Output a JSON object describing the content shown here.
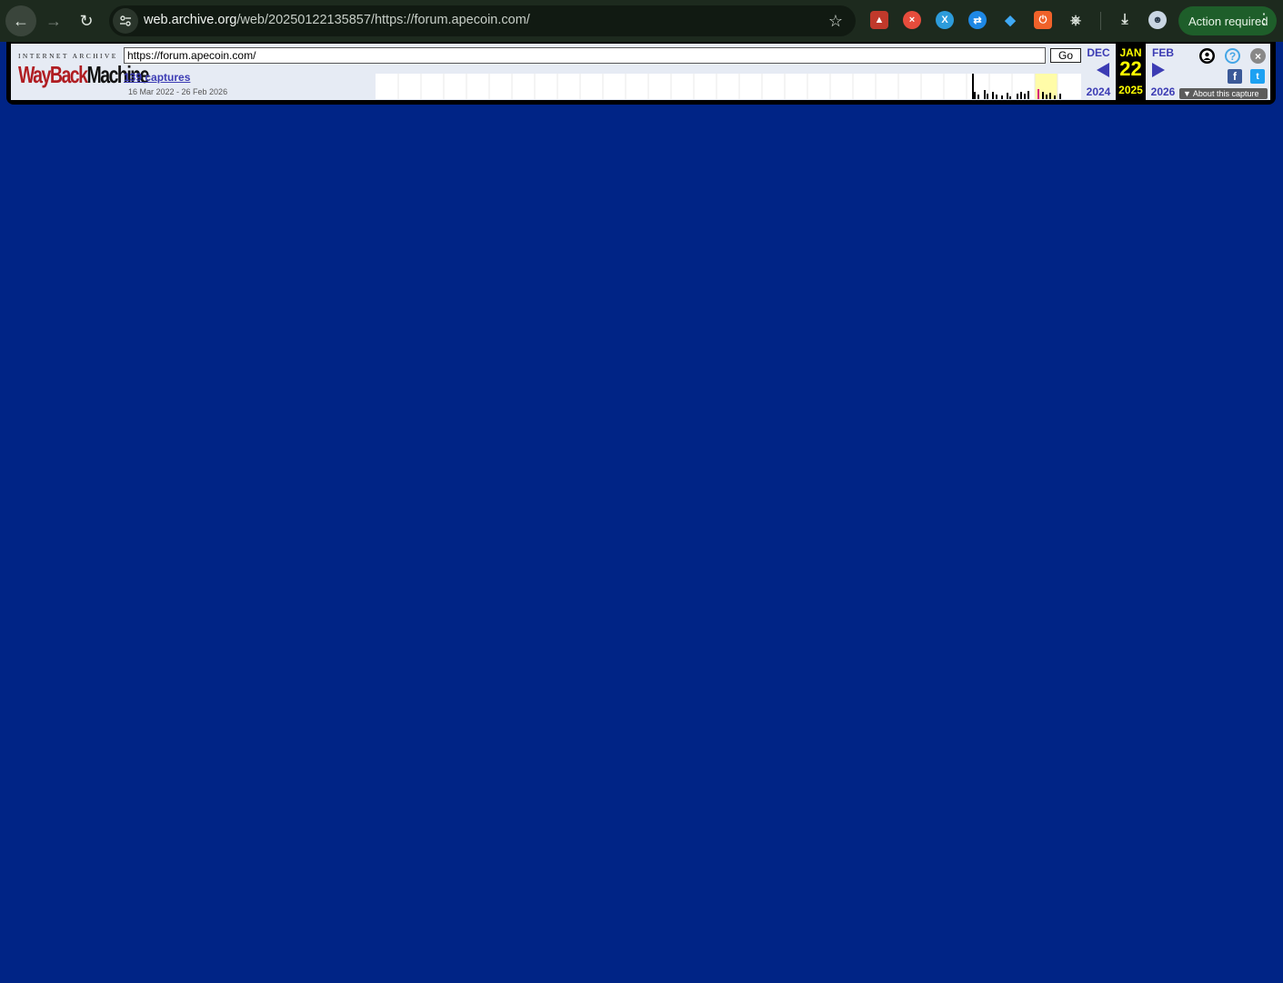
{
  "browser": {
    "url_host": "web.archive.org",
    "url_path": "/web/20250122135857/https://forum.apecoin.com/",
    "action_required_label": "Action required",
    "icons": {
      "back": "back-arrow-icon",
      "forward": "forward-arrow-icon",
      "reload": "reload-icon",
      "site_info": "tune-icon",
      "bookmark": "star-icon",
      "extensions": "puzzle-icon",
      "downloads": "download-icon",
      "profile": "avatar-icon",
      "menu": "kebab-menu-icon"
    }
  },
  "wayback": {
    "logo_top": "INTERNET ARCHIVE",
    "logo_word_red": "WayBack",
    "logo_word_black": "Machine",
    "url_input_value": "https://forum.apecoin.com/",
    "go_label": "Go",
    "captures_label": "139 captures",
    "date_range": "16 Mar 2022 - 26 Feb 2026",
    "prev": {
      "month": "DEC",
      "year": "2024"
    },
    "current": {
      "month": "JAN",
      "day": "22",
      "year": "2025"
    },
    "next": {
      "month": "FEB",
      "year": "2026"
    },
    "about_label": "About this capture"
  },
  "colors": {
    "page_background": "#002486",
    "wayback_link": "#3c3cb4",
    "current_date": "#ffff00"
  }
}
